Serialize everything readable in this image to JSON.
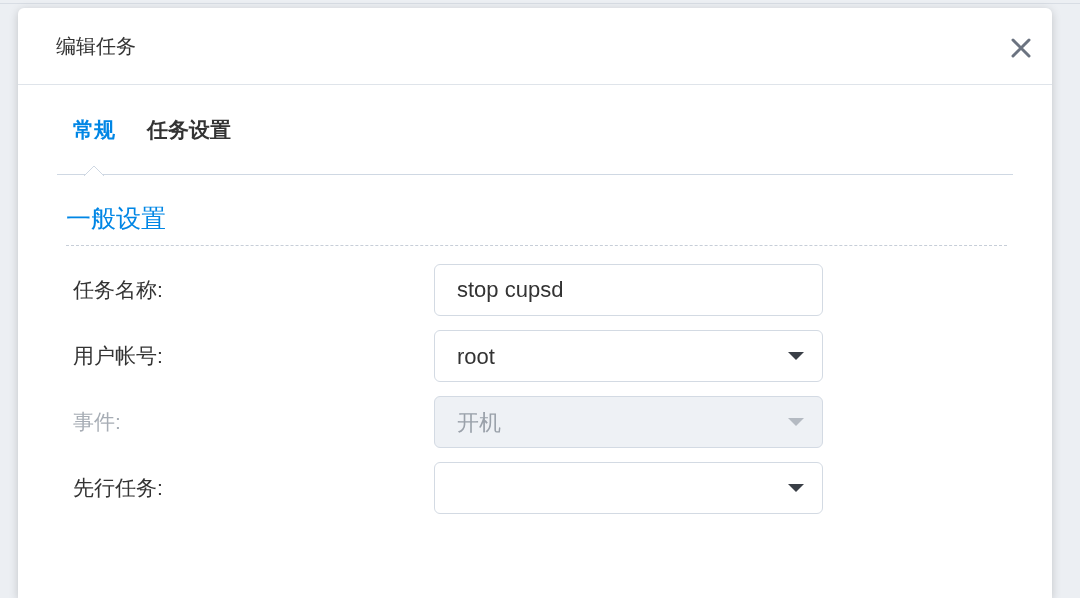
{
  "dialog": {
    "title": "编辑任务"
  },
  "tabs": [
    {
      "label": "常规",
      "selected": true
    },
    {
      "label": "任务设置",
      "selected": false
    }
  ],
  "section": {
    "title": "一般设置"
  },
  "fields": [
    {
      "label": "任务名称:",
      "kind": "text",
      "value": "stop cupsd",
      "disabled": false
    },
    {
      "label": "用户帐号:",
      "kind": "select",
      "value": "root",
      "disabled": false
    },
    {
      "label": "事件:",
      "kind": "select",
      "value": "开机",
      "disabled": true
    },
    {
      "label": "先行任务:",
      "kind": "select",
      "disabled": false
    }
  ]
}
